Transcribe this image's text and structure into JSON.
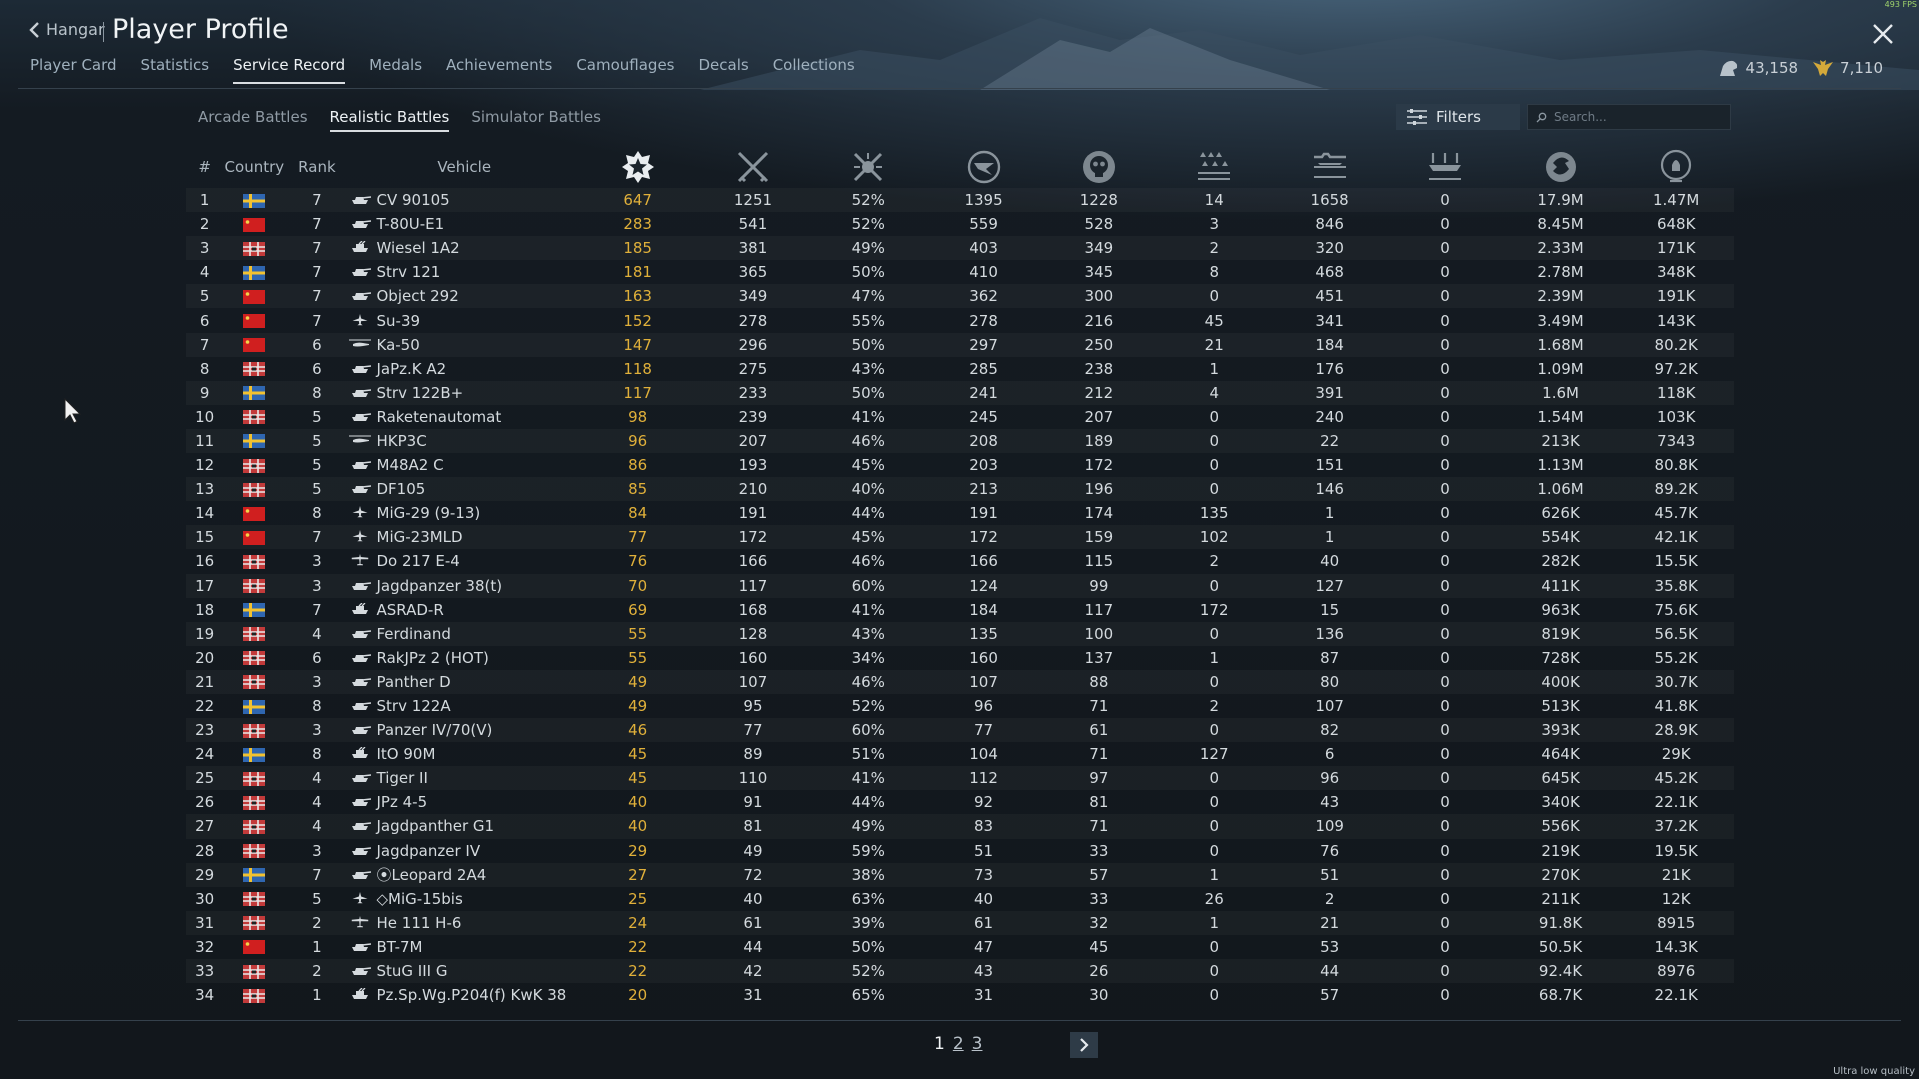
{
  "header": {
    "back_label": "Hangar",
    "title": "Player Profile"
  },
  "tabs": [
    "Player Card",
    "Statistics",
    "Service Record",
    "Medals",
    "Achievements",
    "Camouflages",
    "Decals",
    "Collections"
  ],
  "active_tab": "Service Record",
  "currency": {
    "silver": "43,158",
    "gold": "7,110"
  },
  "battle_modes": [
    "Arcade Battles",
    "Realistic Battles",
    "Simulator Battles"
  ],
  "active_mode": "Realistic Battles",
  "filters_label": "Filters",
  "search": {
    "placeholder": "Search...",
    "value": ""
  },
  "table": {
    "columns": {
      "num": "#",
      "country": "Country",
      "rank": "Rank",
      "vehicle": "Vehicle"
    },
    "icon_columns": [
      "victories-icon",
      "battles-icon",
      "win-rate-icon",
      "respawns-icon",
      "deaths-icon",
      "air-kills-icon",
      "ground-kills-icon",
      "naval-kills-icon",
      "activity-icon",
      "research-icon"
    ],
    "rows": [
      {
        "n": "1",
        "country": "sweden",
        "rank": "7",
        "type": "tank",
        "vehicle": "CV 90105",
        "v": "647",
        "b": "1251",
        "w": "52%",
        "s": "1395",
        "d": "1228",
        "ak": "14",
        "gk": "1658",
        "nk": "0",
        "sl": "17.9M",
        "rp": "1.47M"
      },
      {
        "n": "2",
        "country": "china",
        "rank": "7",
        "type": "tank",
        "vehicle": "T-80U-E1",
        "v": "283",
        "b": "541",
        "w": "52%",
        "s": "559",
        "d": "528",
        "ak": "3",
        "gk": "846",
        "nk": "0",
        "sl": "8.45M",
        "rp": "648K"
      },
      {
        "n": "3",
        "country": "germany",
        "rank": "7",
        "type": "spaa",
        "vehicle": "Wiesel 1A2",
        "v": "185",
        "b": "381",
        "w": "49%",
        "s": "403",
        "d": "349",
        "ak": "2",
        "gk": "320",
        "nk": "0",
        "sl": "2.33M",
        "rp": "171K"
      },
      {
        "n": "4",
        "country": "sweden",
        "rank": "7",
        "type": "tank",
        "vehicle": "Strv 121",
        "v": "181",
        "b": "365",
        "w": "50%",
        "s": "410",
        "d": "345",
        "ak": "8",
        "gk": "468",
        "nk": "0",
        "sl": "2.78M",
        "rp": "348K"
      },
      {
        "n": "5",
        "country": "china",
        "rank": "7",
        "type": "tank",
        "vehicle": "Object 292",
        "v": "163",
        "b": "349",
        "w": "47%",
        "s": "362",
        "d": "300",
        "ak": "0",
        "gk": "451",
        "nk": "0",
        "sl": "2.39M",
        "rp": "191K"
      },
      {
        "n": "6",
        "country": "china",
        "rank": "7",
        "type": "jet",
        "vehicle": "Su-39",
        "v": "152",
        "b": "278",
        "w": "55%",
        "s": "278",
        "d": "216",
        "ak": "45",
        "gk": "341",
        "nk": "0",
        "sl": "3.49M",
        "rp": "143K"
      },
      {
        "n": "7",
        "country": "china",
        "rank": "6",
        "type": "heli",
        "vehicle": "Ka-50",
        "v": "147",
        "b": "296",
        "w": "50%",
        "s": "297",
        "d": "250",
        "ak": "21",
        "gk": "184",
        "nk": "0",
        "sl": "1.68M",
        "rp": "80.2K"
      },
      {
        "n": "8",
        "country": "germany",
        "rank": "6",
        "type": "tank",
        "vehicle": "JaPz.K A2",
        "v": "118",
        "b": "275",
        "w": "43%",
        "s": "285",
        "d": "238",
        "ak": "1",
        "gk": "176",
        "nk": "0",
        "sl": "1.09M",
        "rp": "97.2K"
      },
      {
        "n": "9",
        "country": "sweden",
        "rank": "8",
        "type": "tank",
        "vehicle": "Strv 122B+",
        "v": "117",
        "b": "233",
        "w": "50%",
        "s": "241",
        "d": "212",
        "ak": "4",
        "gk": "391",
        "nk": "0",
        "sl": "1.6M",
        "rp": "118K"
      },
      {
        "n": "10",
        "country": "germany",
        "rank": "5",
        "type": "tank",
        "vehicle": "Raketenautomat",
        "v": "98",
        "b": "239",
        "w": "41%",
        "s": "245",
        "d": "207",
        "ak": "0",
        "gk": "240",
        "nk": "0",
        "sl": "1.54M",
        "rp": "103K"
      },
      {
        "n": "11",
        "country": "sweden",
        "rank": "5",
        "type": "heli",
        "vehicle": "HKP3C",
        "v": "96",
        "b": "207",
        "w": "46%",
        "s": "208",
        "d": "189",
        "ak": "0",
        "gk": "22",
        "nk": "0",
        "sl": "213K",
        "rp": "7343"
      },
      {
        "n": "12",
        "country": "germany",
        "rank": "5",
        "type": "tank",
        "vehicle": "M48A2 C",
        "v": "86",
        "b": "193",
        "w": "45%",
        "s": "203",
        "d": "172",
        "ak": "0",
        "gk": "151",
        "nk": "0",
        "sl": "1.13M",
        "rp": "80.8K"
      },
      {
        "n": "13",
        "country": "germany",
        "rank": "5",
        "type": "tank",
        "vehicle": "DF105",
        "v": "85",
        "b": "210",
        "w": "40%",
        "s": "213",
        "d": "196",
        "ak": "0",
        "gk": "146",
        "nk": "0",
        "sl": "1.06M",
        "rp": "89.2K"
      },
      {
        "n": "14",
        "country": "china",
        "rank": "8",
        "type": "jet",
        "vehicle": "MiG-29 (9-13)",
        "v": "84",
        "b": "191",
        "w": "44%",
        "s": "191",
        "d": "174",
        "ak": "135",
        "gk": "1",
        "nk": "0",
        "sl": "626K",
        "rp": "45.7K"
      },
      {
        "n": "15",
        "country": "china",
        "rank": "7",
        "type": "jet",
        "vehicle": "MiG-23MLD",
        "v": "77",
        "b": "172",
        "w": "45%",
        "s": "172",
        "d": "159",
        "ak": "102",
        "gk": "1",
        "nk": "0",
        "sl": "554K",
        "rp": "42.1K"
      },
      {
        "n": "16",
        "country": "germany",
        "rank": "3",
        "type": "plane",
        "vehicle": "Do 217 E-4",
        "v": "76",
        "b": "166",
        "w": "46%",
        "s": "166",
        "d": "115",
        "ak": "2",
        "gk": "40",
        "nk": "0",
        "sl": "282K",
        "rp": "15.5K"
      },
      {
        "n": "17",
        "country": "germany",
        "rank": "3",
        "type": "tank",
        "vehicle": "Jagdpanzer 38(t)",
        "v": "70",
        "b": "117",
        "w": "60%",
        "s": "124",
        "d": "99",
        "ak": "0",
        "gk": "127",
        "nk": "0",
        "sl": "411K",
        "rp": "35.8K"
      },
      {
        "n": "18",
        "country": "sweden",
        "rank": "7",
        "type": "spaa",
        "vehicle": "ASRAD-R",
        "v": "69",
        "b": "168",
        "w": "41%",
        "s": "184",
        "d": "117",
        "ak": "172",
        "gk": "15",
        "nk": "0",
        "sl": "963K",
        "rp": "75.6K"
      },
      {
        "n": "19",
        "country": "germany",
        "rank": "4",
        "type": "tank",
        "vehicle": "Ferdinand",
        "v": "55",
        "b": "128",
        "w": "43%",
        "s": "135",
        "d": "100",
        "ak": "0",
        "gk": "136",
        "nk": "0",
        "sl": "819K",
        "rp": "56.5K"
      },
      {
        "n": "20",
        "country": "germany",
        "rank": "6",
        "type": "tank",
        "vehicle": "RakJPz 2 (HOT)",
        "v": "55",
        "b": "160",
        "w": "34%",
        "s": "160",
        "d": "137",
        "ak": "1",
        "gk": "87",
        "nk": "0",
        "sl": "728K",
        "rp": "55.2K"
      },
      {
        "n": "21",
        "country": "germany",
        "rank": "3",
        "type": "tank",
        "vehicle": "Panther D",
        "v": "49",
        "b": "107",
        "w": "46%",
        "s": "107",
        "d": "88",
        "ak": "0",
        "gk": "80",
        "nk": "0",
        "sl": "400K",
        "rp": "30.7K"
      },
      {
        "n": "22",
        "country": "sweden",
        "rank": "8",
        "type": "tank",
        "vehicle": "Strv 122A",
        "v": "49",
        "b": "95",
        "w": "52%",
        "s": "96",
        "d": "71",
        "ak": "2",
        "gk": "107",
        "nk": "0",
        "sl": "513K",
        "rp": "41.8K"
      },
      {
        "n": "23",
        "country": "germany",
        "rank": "3",
        "type": "tank",
        "vehicle": "Panzer IV/70(V)",
        "v": "46",
        "b": "77",
        "w": "60%",
        "s": "77",
        "d": "61",
        "ak": "0",
        "gk": "82",
        "nk": "0",
        "sl": "393K",
        "rp": "28.9K"
      },
      {
        "n": "24",
        "country": "sweden",
        "rank": "8",
        "type": "spaa",
        "vehicle": "ItO 90M",
        "v": "45",
        "b": "89",
        "w": "51%",
        "s": "104",
        "d": "71",
        "ak": "127",
        "gk": "6",
        "nk": "0",
        "sl": "464K",
        "rp": "29K"
      },
      {
        "n": "25",
        "country": "germany",
        "rank": "4",
        "type": "tank",
        "vehicle": "Tiger II",
        "v": "45",
        "b": "110",
        "w": "41%",
        "s": "112",
        "d": "97",
        "ak": "0",
        "gk": "96",
        "nk": "0",
        "sl": "645K",
        "rp": "45.2K"
      },
      {
        "n": "26",
        "country": "germany",
        "rank": "4",
        "type": "tank",
        "vehicle": "JPz 4-5",
        "v": "40",
        "b": "91",
        "w": "44%",
        "s": "92",
        "d": "81",
        "ak": "0",
        "gk": "43",
        "nk": "0",
        "sl": "340K",
        "rp": "22.1K"
      },
      {
        "n": "27",
        "country": "germany",
        "rank": "4",
        "type": "tank",
        "vehicle": "Jagdpanther G1",
        "v": "40",
        "b": "81",
        "w": "49%",
        "s": "83",
        "d": "71",
        "ak": "0",
        "gk": "109",
        "nk": "0",
        "sl": "556K",
        "rp": "37.2K"
      },
      {
        "n": "28",
        "country": "germany",
        "rank": "3",
        "type": "tank",
        "vehicle": "Jagdpanzer IV",
        "v": "29",
        "b": "49",
        "w": "59%",
        "s": "51",
        "d": "33",
        "ak": "0",
        "gk": "76",
        "nk": "0",
        "sl": "219K",
        "rp": "19.5K"
      },
      {
        "n": "29",
        "country": "sweden",
        "rank": "7",
        "type": "tank",
        "vehicle": "⦿Leopard 2A4",
        "v": "27",
        "b": "72",
        "w": "38%",
        "s": "73",
        "d": "57",
        "ak": "1",
        "gk": "51",
        "nk": "0",
        "sl": "270K",
        "rp": "21K"
      },
      {
        "n": "30",
        "country": "germany",
        "rank": "5",
        "type": "jet",
        "vehicle": "◇MiG-15bis",
        "v": "25",
        "b": "40",
        "w": "63%",
        "s": "40",
        "d": "33",
        "ak": "26",
        "gk": "2",
        "nk": "0",
        "sl": "211K",
        "rp": "12K"
      },
      {
        "n": "31",
        "country": "germany",
        "rank": "2",
        "type": "plane",
        "vehicle": "He 111 H-6",
        "v": "24",
        "b": "61",
        "w": "39%",
        "s": "61",
        "d": "32",
        "ak": "1",
        "gk": "21",
        "nk": "0",
        "sl": "91.8K",
        "rp": "8915"
      },
      {
        "n": "32",
        "country": "china",
        "rank": "1",
        "type": "tank",
        "vehicle": "BT-7M",
        "v": "22",
        "b": "44",
        "w": "50%",
        "s": "47",
        "d": "45",
        "ak": "0",
        "gk": "53",
        "nk": "0",
        "sl": "50.5K",
        "rp": "14.3K"
      },
      {
        "n": "33",
        "country": "germany",
        "rank": "2",
        "type": "tank",
        "vehicle": "StuG III G",
        "v": "22",
        "b": "42",
        "w": "52%",
        "s": "43",
        "d": "26",
        "ak": "0",
        "gk": "44",
        "nk": "0",
        "sl": "92.4K",
        "rp": "8976"
      },
      {
        "n": "34",
        "country": "germany",
        "rank": "1",
        "type": "spaa",
        "vehicle": "Pz.Sp.Wg.P204(f) KwK 38",
        "v": "20",
        "b": "31",
        "w": "65%",
        "s": "31",
        "d": "30",
        "ak": "0",
        "gk": "57",
        "nk": "0",
        "sl": "68.7K",
        "rp": "22.1K"
      }
    ]
  },
  "pagination": {
    "pages": [
      "1",
      "2",
      "3"
    ],
    "current": "1"
  },
  "fps_text": "493 FPS",
  "quality_text": "Ultra low quality",
  "colors": {
    "accent_gold": "#e0b03a",
    "sweden_blue": "#2f66b0",
    "sweden_yellow": "#f2c230",
    "china_red": "#d01f1f",
    "germany_red": "#c23a3a"
  }
}
